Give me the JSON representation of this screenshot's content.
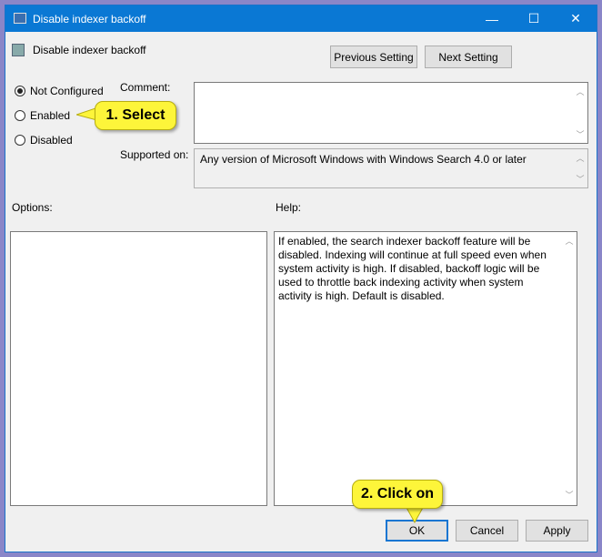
{
  "window": {
    "title": "Disable indexer backoff",
    "minimize": "—",
    "maximize": "☐",
    "close": "✕"
  },
  "header": {
    "policy_name": "Disable indexer backoff",
    "previous_setting": "Previous Setting",
    "next_setting": "Next Setting"
  },
  "state": {
    "options": [
      {
        "label": "Not Configured",
        "selected": true
      },
      {
        "label": "Enabled",
        "selected": false
      },
      {
        "label": "Disabled",
        "selected": false
      }
    ]
  },
  "comment": {
    "label": "Comment:",
    "value": ""
  },
  "supported": {
    "label": "Supported on:",
    "value": "Any version of Microsoft Windows with Windows Search 4.0 or later"
  },
  "options_label": "Options:",
  "help": {
    "label": "Help:",
    "text": "If enabled, the search indexer backoff feature will be disabled. Indexing will continue at full speed even when system activity is high. If disabled, backoff logic will be used to throttle back indexing activity when system activity is high. Default is disabled."
  },
  "footer": {
    "ok": "OK",
    "cancel": "Cancel",
    "apply": "Apply"
  },
  "annotations": {
    "step1": "1. Select",
    "step2": "2. Click on"
  }
}
